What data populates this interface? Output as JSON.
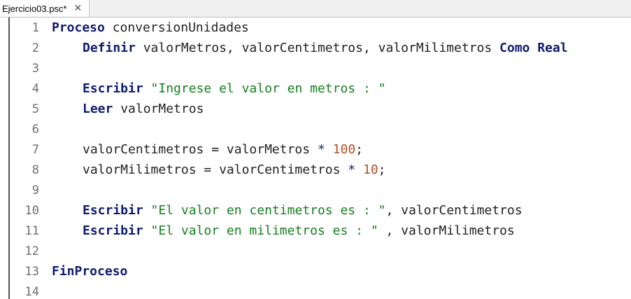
{
  "tab": {
    "filename": "Ejercicio03.psc*",
    "close_glyph": "✕"
  },
  "lines": [
    {
      "n": "1",
      "tokens": [
        {
          "t": "kw",
          "v": "Proceso"
        },
        {
          "t": "id",
          "v": " conversionUnidades"
        }
      ]
    },
    {
      "n": "2",
      "indent": true,
      "tokens": [
        {
          "t": "kw",
          "v": "Definir"
        },
        {
          "t": "id",
          "v": " valorMetros, valorCentimetros, valorMilimetros "
        },
        {
          "t": "kw",
          "v": "Como Real"
        }
      ]
    },
    {
      "n": "3",
      "tokens": []
    },
    {
      "n": "4",
      "indent": true,
      "tokens": [
        {
          "t": "kw",
          "v": "Escribir"
        },
        {
          "t": "id",
          "v": " "
        },
        {
          "t": "str",
          "v": "\"Ingrese el valor en metros : \""
        }
      ]
    },
    {
      "n": "5",
      "indent": true,
      "tokens": [
        {
          "t": "kw",
          "v": "Leer"
        },
        {
          "t": "id",
          "v": " valorMetros"
        }
      ]
    },
    {
      "n": "6",
      "tokens": []
    },
    {
      "n": "7",
      "indent": true,
      "tokens": [
        {
          "t": "id",
          "v": "valorCentimetros = valorMetros "
        },
        {
          "t": "op",
          "v": "*"
        },
        {
          "t": "id",
          "v": " "
        },
        {
          "t": "num",
          "v": "100"
        },
        {
          "t": "id",
          "v": ";"
        }
      ]
    },
    {
      "n": "8",
      "indent": true,
      "tokens": [
        {
          "t": "id",
          "v": "valorMilimetros = valorCentimetros "
        },
        {
          "t": "op",
          "v": "*"
        },
        {
          "t": "id",
          "v": " "
        },
        {
          "t": "num",
          "v": "10"
        },
        {
          "t": "id",
          "v": ";"
        }
      ]
    },
    {
      "n": "9",
      "tokens": []
    },
    {
      "n": "10",
      "indent": true,
      "tokens": [
        {
          "t": "kw",
          "v": "Escribir"
        },
        {
          "t": "id",
          "v": " "
        },
        {
          "t": "str",
          "v": "\"El valor en centimetros es : \""
        },
        {
          "t": "id",
          "v": ", valorCentimetros"
        }
      ]
    },
    {
      "n": "11",
      "indent": true,
      "tokens": [
        {
          "t": "kw",
          "v": "Escribir"
        },
        {
          "t": "id",
          "v": " "
        },
        {
          "t": "str",
          "v": "\"El valor en milimetros es : \""
        },
        {
          "t": "id",
          "v": " , valorMilimetros"
        }
      ]
    },
    {
      "n": "12",
      "tokens": []
    },
    {
      "n": "13",
      "tokens": [
        {
          "t": "kw",
          "v": "FinProceso"
        }
      ]
    },
    {
      "n": "14",
      "tokens": []
    }
  ],
  "colors": {
    "keyword": "#0f1b6e",
    "string": "#157e1f",
    "number": "#b0512a",
    "line_number": "#6e6e6e"
  }
}
